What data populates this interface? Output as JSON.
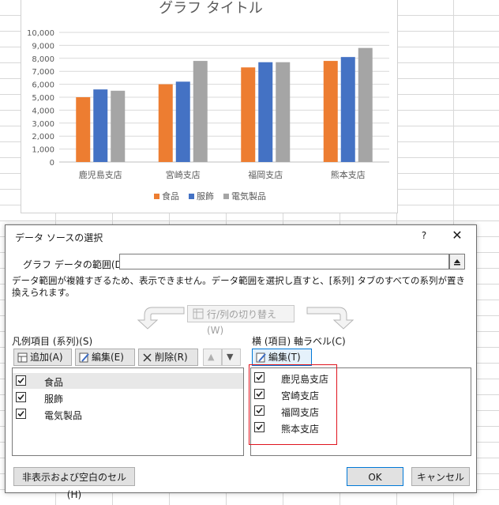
{
  "chart_data": {
    "type": "bar",
    "title": "グラフ タイトル",
    "categories": [
      "鹿児島支店",
      "宮崎支店",
      "福岡支店",
      "熊本支店"
    ],
    "series": [
      {
        "name": "食品",
        "color": "#ed7d31",
        "values": [
          5000,
          6000,
          7300,
          7800
        ]
      },
      {
        "name": "服飾",
        "color": "#4472c4",
        "values": [
          5600,
          6200,
          7700,
          8100
        ]
      },
      {
        "name": "電気製品",
        "color": "#a5a5a5",
        "values": [
          5500,
          7800,
          7700,
          8800
        ]
      }
    ],
    "yticks": [
      "10,000",
      "9,000",
      "8,000",
      "7,000",
      "6,000",
      "5,000",
      "4,000",
      "3,000",
      "2,000",
      "1,000",
      "0"
    ],
    "ylim": [
      0,
      10000
    ],
    "grid": true,
    "legend": "bottom"
  },
  "dialog": {
    "title": "データ ソースの選択",
    "help": "?",
    "close": "✕",
    "range_label": "グラフ データの範囲(D):",
    "range_value": "",
    "warning": "データ範囲が複雑すぎるため、表示できません。データ範囲を選択し直すと、[系列] タブのすべての系列が置き換えられます。",
    "switch_label": "行/列の切り替え(W)",
    "legend_section": {
      "label": "凡例項目 (系列)(S)",
      "add": "追加(A)",
      "edit": "編集(E)",
      "delete": "削除(R)",
      "up": "▲",
      "down": "▼",
      "items": [
        "食品",
        "服飾",
        "電気製品"
      ]
    },
    "axis_section": {
      "label": "横 (項目) 軸ラベル(C)",
      "edit": "編集(T)",
      "items": [
        "鹿児島支店",
        "宮崎支店",
        "福岡支店",
        "熊本支店"
      ]
    },
    "hidden_cells": "非表示および空白のセル(H)",
    "ok": "OK",
    "cancel": "キャンセル"
  },
  "colors": {
    "accent": "#0078d7",
    "highlight": "#e0141e"
  }
}
